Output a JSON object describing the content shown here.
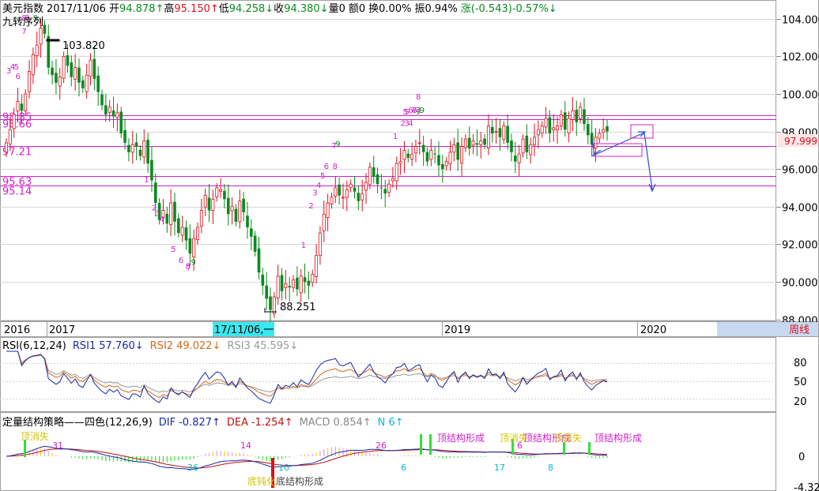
{
  "header": {
    "name": "美元指数",
    "date": "2017/11/06",
    "open_label": "开",
    "open": "94.878↑",
    "high_label": "高",
    "high": "95.150↑",
    "low_label": "低",
    "low": "94.258↓",
    "close_label": "收",
    "close": "94.380↓",
    "vol": "量0",
    "amount": "额0",
    "turnover": "换0.00%",
    "amplitude": "振0.94%",
    "change": "涨(-0.543)-0.57%↓",
    "indicator": "九转序列"
  },
  "colors": {
    "up": "#e0101b",
    "down": "#0a8a1e",
    "magenta": "#d020c8",
    "grid": "#d6d6d6",
    "rsi1": "#1a2aa6",
    "rsi2": "#d2691e",
    "rsi3": "#999999",
    "dif": "#1a2aa6",
    "dea": "#c01010",
    "macd_label": "#1a2aa6",
    "n_label": "#00bcd4",
    "arrow": "#2a49d8",
    "crosshair_bg": "#3ce8f0",
    "price_tag_bg": "#ffe6e6"
  },
  "price_axis": {
    "ticks": [
      "104.000",
      "102.000",
      "100.000",
      "98.000",
      "96.000",
      "94.000",
      "92.000",
      "90.000",
      "88.000"
    ],
    "ylim": [
      87.9,
      105.0
    ]
  },
  "current_price": "97.999",
  "levels": [
    {
      "label": "98.85",
      "value": 98.85
    },
    {
      "label": "98.66",
      "value": 98.66
    },
    {
      "label": "97.21",
      "value": 97.21
    },
    {
      "label": "95.63",
      "value": 95.63
    },
    {
      "label": "95.14",
      "value": 95.14
    }
  ],
  "annotations": {
    "high_label": "103.820",
    "low_label": "88.251"
  },
  "time_axis": {
    "labels": [
      "2016",
      "2017",
      "2019",
      "2020"
    ],
    "crosshair": "17/11/06,一",
    "period": "周线"
  },
  "rsi": {
    "title": "RSI(6,12,24)",
    "rsi1_label": "RSI1",
    "rsi1": "57.760↓",
    "rsi2_label": "RSI2",
    "rsi2": "49.022↓",
    "rsi3_label": "RSI3",
    "rsi3": "45.595↓",
    "ticks": [
      "80",
      "50",
      "20"
    ]
  },
  "macd": {
    "title": "定量结构策略——四色(12,26,9)",
    "dif_label": "DIF",
    "dif": "-0.827↑",
    "dea_label": "DEA",
    "dea": "-1.254↑",
    "macd_label": "MACD",
    "macd": "0.854↑",
    "n_label": "N",
    "n": "6↑",
    "ticks": [
      "0",
      "-4.32"
    ],
    "texts": [
      {
        "text": "顶消失",
        "color": "#d4c400"
      },
      {
        "text": "底钝化",
        "color": "#d4c400"
      },
      {
        "text": "底结构形成",
        "color": "#444444"
      },
      {
        "text": "顶结构形成",
        "color": "#d020c8"
      },
      {
        "text": "顶消失",
        "color": "#d4c400"
      },
      {
        "text": "顶结构形成",
        "color": "#d020c8"
      },
      {
        "text": "顶消失",
        "color": "#d4c400"
      },
      {
        "text": "顶结构形成",
        "color": "#d020c8"
      }
    ],
    "numbers": [
      "31",
      "36",
      "14",
      "10",
      "26",
      "6",
      "17",
      "8",
      "6"
    ]
  },
  "nine_labels": [
    {
      "t": "8",
      "c": "#d020c8"
    },
    {
      "t": "9",
      "c": "#0a8a1e"
    },
    {
      "t": "7",
      "c": "#d020c8"
    },
    {
      "t": "3",
      "c": "#d020c8"
    },
    {
      "t": "4",
      "c": "#d020c8"
    },
    {
      "t": "5",
      "c": "#d020c8"
    },
    {
      "t": "6",
      "c": "#d020c8"
    },
    {
      "t": "1",
      "c": "#d020c8"
    },
    {
      "t": "2",
      "c": "#d020c8"
    },
    {
      "t": "3",
      "c": "#d020c8"
    },
    {
      "t": "4",
      "c": "#d020c8"
    },
    {
      "t": "5",
      "c": "#d020c8"
    },
    {
      "t": "6",
      "c": "#d020c8"
    },
    {
      "t": "7",
      "c": "#d020c8"
    },
    {
      "t": "8",
      "c": "#d020c8"
    },
    {
      "t": "9",
      "c": "#0a8a1e"
    },
    {
      "t": "1",
      "c": "#d020c8"
    },
    {
      "t": "2",
      "c": "#d020c8"
    },
    {
      "t": "3",
      "c": "#d020c8"
    },
    {
      "t": "4",
      "c": "#d020c8"
    },
    {
      "t": "5",
      "c": "#d020c8"
    },
    {
      "t": "6",
      "c": "#d020c8"
    },
    {
      "t": "7",
      "c": "#d020c8"
    },
    {
      "t": "8",
      "c": "#d020c8"
    },
    {
      "t": "9",
      "c": "#0a8a1e"
    },
    {
      "t": "1",
      "c": "#d020c8"
    },
    {
      "t": "2",
      "c": "#d020c8"
    },
    {
      "t": "3",
      "c": "#d020c8"
    },
    {
      "t": "4",
      "c": "#d020c8"
    },
    {
      "t": "5",
      "c": "#d020c8"
    },
    {
      "t": "6",
      "c": "#d020c8"
    },
    {
      "t": "7",
      "c": "#d020c8"
    },
    {
      "t": "8",
      "c": "#d020c8"
    },
    {
      "t": "9",
      "c": "#0a8a1e"
    },
    {
      "t": "8",
      "c": "#d020c8"
    },
    {
      "t": "5",
      "c": "#d020c8"
    },
    {
      "t": "6",
      "c": "#d020c8"
    },
    {
      "t": "7",
      "c": "#d020c8"
    },
    {
      "t": "9",
      "c": "#0a8a1e"
    }
  ],
  "chart_data": {
    "type": "candlestick",
    "title": "美元指数",
    "period": "weekly",
    "ylim": [
      87.9,
      105.0
    ],
    "close": [
      97.4,
      98.1,
      98.9,
      99.6,
      99.1,
      100.0,
      101.2,
      102.1,
      102.6,
      103.5,
      103.2,
      101.4,
      101.0,
      100.6,
      100.9,
      102.0,
      101.5,
      100.9,
      101.4,
      100.6,
      100.3,
      101.0,
      101.8,
      100.8,
      100.1,
      99.4,
      98.9,
      99.3,
      98.8,
      99.0,
      97.9,
      97.4,
      96.9,
      97.3,
      97.2,
      96.7,
      97.5,
      96.3,
      95.4,
      94.2,
      93.3,
      93.8,
      93.1,
      94.2,
      93.2,
      92.6,
      92.9,
      92.2,
      91.5,
      92.3,
      92.9,
      93.8,
      94.6,
      93.8,
      94.4,
      95.0,
      94.9,
      94.4,
      93.6,
      94.0,
      93.2,
      94.3,
      93.7,
      92.9,
      92.4,
      91.6,
      90.5,
      89.8,
      89.1,
      88.5,
      89.2,
      90.3,
      89.5,
      89.9,
      89.7,
      90.1,
      89.6,
      90.3,
      90.0,
      89.8,
      90.4,
      91.4,
      92.6,
      93.6,
      94.2,
      94.5,
      95.0,
      94.6,
      94.5,
      94.9,
      95.2,
      94.8,
      94.3,
      94.7,
      95.3,
      96.1,
      95.6,
      95.2,
      95.0,
      94.7,
      95.2,
      95.5,
      96.3,
      96.4,
      97.0,
      96.6,
      96.8,
      97.2,
      97.4,
      96.9,
      96.4,
      97.0,
      96.8,
      96.2,
      96.0,
      96.4,
      96.9,
      97.3,
      96.5,
      97.2,
      97.6,
      97.1,
      97.5,
      97.3,
      97.5,
      97.3,
      98.3,
      97.9,
      98.0,
      97.7,
      98.3,
      97.4,
      96.9,
      96.4,
      96.8,
      97.6,
      96.9,
      97.3,
      97.7,
      98.1,
      98.3,
      98.7,
      97.9,
      98.2,
      98.3,
      98.9,
      98.1,
      98.7,
      99.1,
      98.5,
      99.3,
      98.4,
      97.8,
      97.3,
      97.7,
      97.9,
      98.1,
      98.0
    ]
  }
}
